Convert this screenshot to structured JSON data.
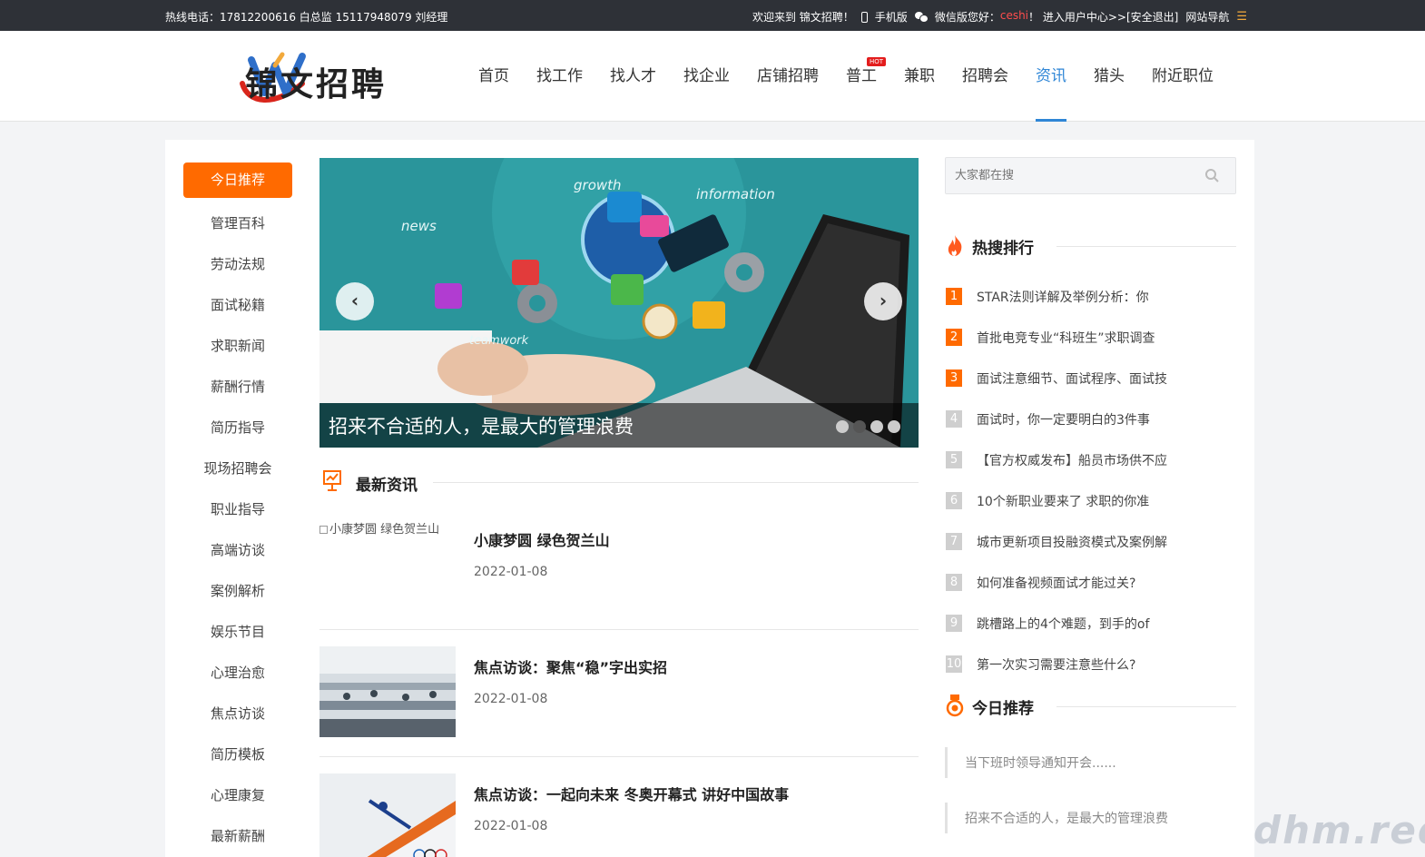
{
  "topbar": {
    "hotline": "热线电话：17812200616 白总监 15117948079 刘经理",
    "welcome": "欢迎来到 锦文招聘！",
    "mobile": "手机版",
    "wechat": "微信版",
    "greeting": "您好：",
    "username": "ceshi",
    "user_center": "！ 进入用户中心>>",
    "logout": "[安全退出]",
    "site_nav": "网站导航",
    "menu_glyph": "☰"
  },
  "header": {
    "logo_text": "锦文招聘",
    "nav": [
      "首页",
      "找工作",
      "找人才",
      "找企业",
      "店铺招聘",
      "普工",
      "兼职",
      "招聘会",
      "资讯",
      "猎头",
      "附近职位"
    ],
    "hot_badge": "HOT",
    "active_nav": "资讯"
  },
  "sidebar": {
    "categories": [
      "今日推荐",
      "管理百科",
      "劳动法规",
      "面试秘籍",
      "求职新闻",
      "薪酬行情",
      "简历指导",
      "现场招聘会",
      "职业指导",
      "高端访谈",
      "案例解析",
      "娱乐节目",
      "心理治愈",
      "焦点访谈",
      "简历模板",
      "心理康复",
      "最新薪酬"
    ]
  },
  "banner": {
    "caption": "招来不合适的人，是最大的管理浪费",
    "prev": "‹",
    "next": "›",
    "slide_count": 4,
    "active_slide": 2,
    "overlay_words": [
      "growth",
      "information",
      "news",
      "teamwork"
    ]
  },
  "latest": {
    "title": "最新资讯",
    "items": [
      {
        "title": "小康梦圆 绿色贺兰山",
        "date": "2022-01-08",
        "image_alt": "小康梦圆 绿色贺兰山"
      },
      {
        "title": "焦点访谈：聚焦“稳”字出实招",
        "date": "2022-01-08"
      },
      {
        "title": "焦点访谈：一起向未来 冬奥开幕式 讲好中国故事",
        "date": "2022-01-08"
      }
    ]
  },
  "search": {
    "placeholder": "大家都在搜"
  },
  "hot_ranking": {
    "title": "热搜排行",
    "items": [
      "STAR法则详解及举例分析：你",
      "首批电竞专业“科班生”求职调查",
      "面试注意细节、面试程序、面试技",
      "面试时，你一定要明白的3件事",
      "【官方权威发布】船员市场供不应",
      "10个新职业要来了 求职的你准",
      "城市更新项目投融资模式及案例解",
      "如何准备视频面试才能过关?",
      "跳槽路上的4个难题，到手的of",
      "第一次实习需要注意些什么?"
    ]
  },
  "today_rec": {
    "title": "今日推荐",
    "items": [
      "当下班时领导通知开会......",
      "招来不合适的人，是最大的管理浪费"
    ]
  },
  "colors": {
    "accent": "#ff6a00",
    "nav_active": "#2f86d6",
    "topbar": "#2e3137"
  },
  "watermark": "dhm.red"
}
